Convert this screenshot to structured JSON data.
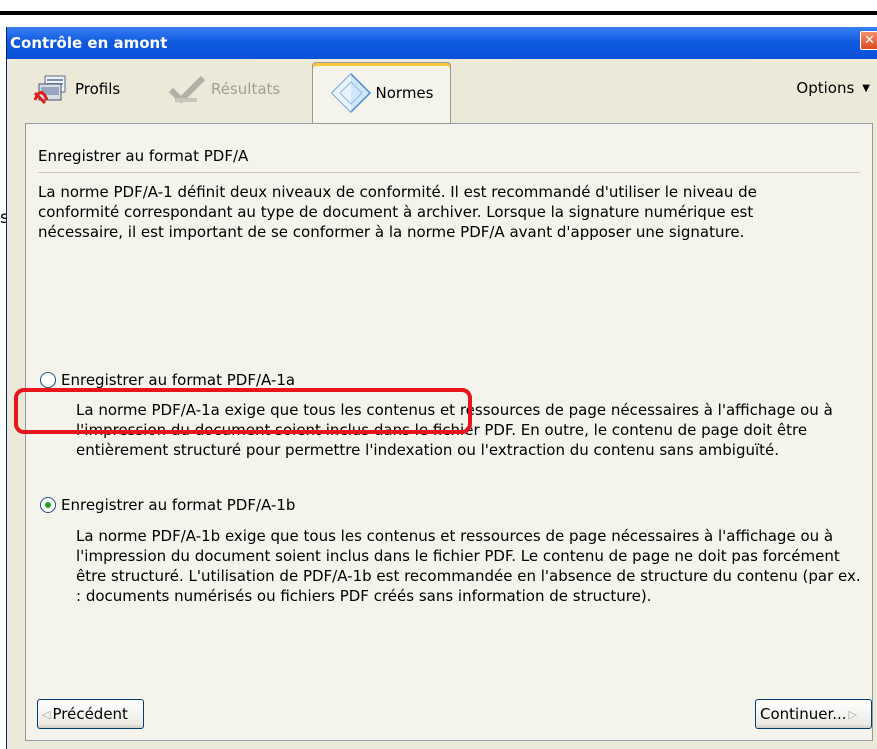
{
  "window": {
    "title": "Contrôle en amont",
    "close_glyph": "✕"
  },
  "tabs": [
    {
      "label": "Profils",
      "icon": "profiles-icon",
      "state": "normal"
    },
    {
      "label": "Résultats",
      "icon": "results-icon",
      "state": "disabled"
    },
    {
      "label": "Normes",
      "icon": "standards-icon",
      "state": "active"
    }
  ],
  "options": {
    "label": "Options",
    "caret": "▼"
  },
  "left_edge_char": "s",
  "panel": {
    "section_title": "Enregistrer au format PDF/A",
    "intro": "La norme PDF/A-1 définit deux niveaux de conformité. Il est recommandé d'utiliser le niveau de conformité correspondant au type de document à archiver. Lorsque la signature numérique est nécessaire, il est important de se conformer à la norme PDF/A avant d'apposer une signature.",
    "options": [
      {
        "label": "Enregistrer au format PDF/A-1a",
        "selected": false,
        "description": "La norme PDF/A-1a exige que tous les contenus et ressources de page nécessaires à l'affichage ou à l'impression du document soient inclus dans le fichier PDF. En outre, le contenu de page doit être entièrement structuré pour permettre l'indexation ou l'extraction du contenu sans ambiguïté."
      },
      {
        "label": "Enregistrer au format PDF/A-1b",
        "selected": true,
        "description": "La norme PDF/A-1b exige que tous les contenus et ressources de page nécessaires à l'affichage ou à l'impression du document soient inclus dans le fichier PDF. Le contenu de page ne doit pas forcément être structuré. L'utilisation de PDF/A-1b est recommandée en l'absence de structure du contenu (par ex. : documents numérisés ou fichiers PDF créés sans information de structure)."
      }
    ]
  },
  "buttons": {
    "prev": {
      "label": "Précédent",
      "arrow": "◁"
    },
    "next": {
      "label": "Continuer...",
      "arrow": "▷"
    }
  },
  "colors": {
    "highlight": "#e8141c",
    "titlebar": "#0950d8",
    "panel": "#f4f3ec",
    "window": "#ece9d8"
  }
}
